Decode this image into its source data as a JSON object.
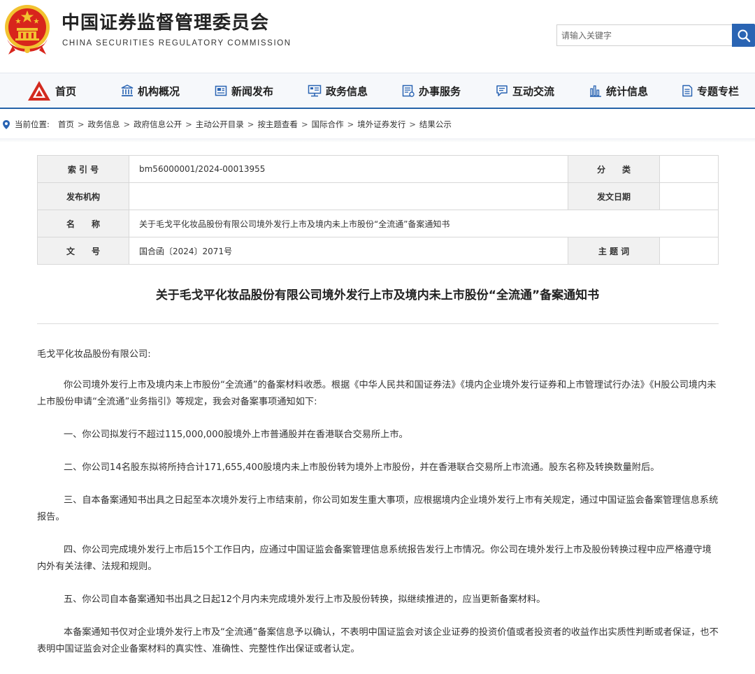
{
  "header": {
    "site_title": "中国证券监督管理委员会",
    "site_subtitle": "CHINA SECURITIES REGULATORY COMMISSION",
    "search_placeholder": "请输入关键字"
  },
  "nav": {
    "items": [
      {
        "label": "首页",
        "icon": "csrc-logo-icon"
      },
      {
        "label": "机构概况",
        "icon": "building-icon"
      },
      {
        "label": "新闻发布",
        "icon": "news-icon"
      },
      {
        "label": "政务信息",
        "icon": "monitor-icon"
      },
      {
        "label": "办事服务",
        "icon": "service-list-icon"
      },
      {
        "label": "互动交流",
        "icon": "chat-icon"
      },
      {
        "label": "统计信息",
        "icon": "bar-chart-icon"
      },
      {
        "label": "专题专栏",
        "icon": "document-icon"
      }
    ]
  },
  "breadcrumb": {
    "prefix": "当前位置:",
    "items": [
      "首页",
      "政务信息",
      "政府信息公开",
      "主动公开目录",
      "按主题查看",
      "国际合作",
      "境外证券发行",
      "结果公示"
    ]
  },
  "info_table": {
    "index_label": "索 引 号",
    "index_value": "bm56000001/2024-00013955",
    "category_label": "分　　类",
    "category_value": "",
    "publisher_label": "发布机构",
    "publisher_value": "",
    "date_label": "发文日期",
    "date_value": "",
    "name_label": "名　　称",
    "name_value": "关于毛戈平化妆品股份有限公司境外发行上市及境内未上市股份“全流通”备案通知书",
    "docno_label": "文　　号",
    "docno_value": "国合函〔2024〕2071号",
    "keywords_label": "主 题 词",
    "keywords_value": ""
  },
  "document": {
    "title": "关于毛戈平化妆品股份有限公司境外发行上市及境内未上市股份“全流通”备案通知书",
    "salutation": "毛戈平化妆品股份有限公司:",
    "paragraphs": [
      "你公司境外发行上市及境内未上市股份“全流通”的备案材料收悉。根据《中华人民共和国证券法》《境内企业境外发行证券和上市管理试行办法》《H股公司境内未上市股份申请“全流通”业务指引》等规定，我会对备案事项通知如下:",
      "一、你公司拟发行不超过115,000,000股境外上市普通股并在香港联合交易所上市。",
      "二、你公司14名股东拟将所持合计171,655,400股境内未上市股份转为境外上市股份，并在香港联合交易所上市流通。股东名称及转换数量附后。",
      "三、自本备案通知书出具之日起至本次境外发行上市结束前，你公司如发生重大事项，应根据境内企业境外发行上市有关规定，通过中国证监会备案管理信息系统报告。",
      "四、你公司完成境外发行上市后15个工作日内，应通过中国证监会备案管理信息系统报告发行上市情况。你公司在境外发行上市及股份转换过程中应严格遵守境内外有关法律、法规和规则。",
      "五、你公司自本备案通知书出具之日起12个月内未完成境外发行上市及股份转换，拟继续推进的，应当更新备案材料。",
      "本备案通知书仅对企业境外发行上市及“全流通”备案信息予以确认，不表明中国证监会对该企业证券的投资价值或者投资者的收益作出实质性判断或者保证，也不表明中国证监会对企业备案材料的真实性、准确性、完整性作出保证或者认定。"
    ]
  },
  "colors": {
    "nav_underline": "#2563a8",
    "search_button": "#2a64b3",
    "emblem_red": "#d8251c",
    "emblem_gold": "#f2c230",
    "table_label_bg": "#f1f1f1"
  }
}
